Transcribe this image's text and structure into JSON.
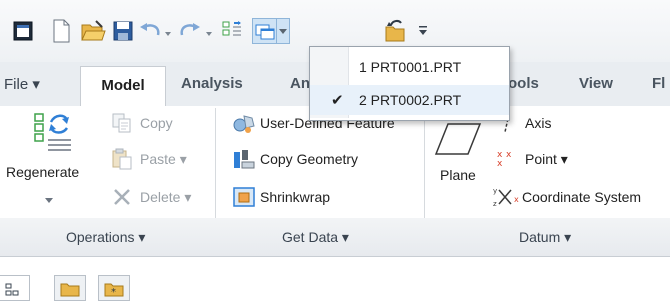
{
  "quick_access": {
    "buttons": [
      "window-icon",
      "new-icon",
      "open-icon",
      "save-icon",
      "undo-icon",
      "redo-icon",
      "regenerate-icon",
      "windows-icon",
      "close-icon",
      "customize-icon"
    ]
  },
  "tabs": {
    "file": "File ▾",
    "model": "Model",
    "analysis": "Analysis",
    "an_partial": "An",
    "tools_partial": "ools",
    "view": "View",
    "fl_partial": "Fl"
  },
  "operations": {
    "regenerate": "Regenerate",
    "copy": "Copy",
    "paste": "Paste ▾",
    "delete": "Delete ▾"
  },
  "get_data": {
    "udf": "User-Defined Feature",
    "copy_geometry": "Copy Geometry",
    "shrinkwrap": "Shrinkwrap"
  },
  "datum": {
    "plane": "Plane",
    "axis": "Axis",
    "point": "Point ▾",
    "coordinate_system": "Coordinate System"
  },
  "groups": {
    "operations": "Operations ▾",
    "get_data": "Get Data ▾",
    "datum": "Datum ▾"
  },
  "windows_menu": {
    "items": [
      {
        "label": "1 PRT0001.PRT",
        "checked": false
      },
      {
        "label": "2 PRT0002.PRT",
        "checked": true
      }
    ],
    "check_glyph": "✔"
  },
  "colors": {
    "accent": "#2f7fd6",
    "ribbon_bg": "#ffffff",
    "tabbar_bg": "#e9edf1"
  }
}
